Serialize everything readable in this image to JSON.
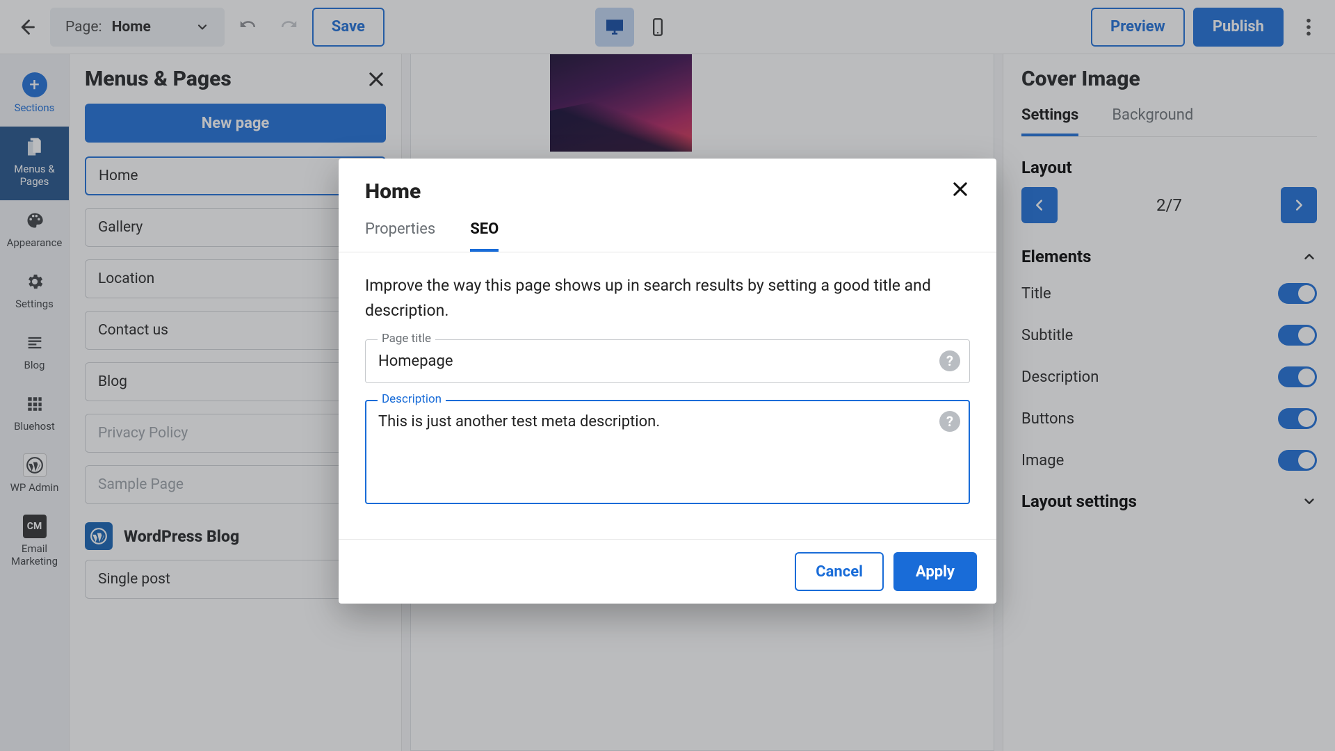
{
  "topbar": {
    "page_label": "Page:",
    "page_value": "Home",
    "save": "Save",
    "preview": "Preview",
    "publish": "Publish"
  },
  "rail": {
    "sections": "Sections",
    "menus_pages": "Menus & Pages",
    "appearance": "Appearance",
    "settings": "Settings",
    "blog": "Blog",
    "bluehost": "Bluehost",
    "wp_admin": "WP Admin",
    "email_marketing": "Email Marketing",
    "cm_badge": "CM"
  },
  "leftpanel": {
    "title": "Menus & Pages",
    "new_page": "New page",
    "pages": [
      {
        "label": "Home",
        "selected": true,
        "home": true
      },
      {
        "label": "Gallery"
      },
      {
        "label": "Location"
      },
      {
        "label": "Contact us"
      },
      {
        "label": "Blog"
      },
      {
        "label": "Privacy Policy",
        "hidden": true
      },
      {
        "label": "Sample Page",
        "hidden": true
      }
    ],
    "site_title": "WordPress Blog",
    "single_post": "Single post"
  },
  "rightpanel": {
    "title": "Cover Image",
    "tabs": {
      "settings": "Settings",
      "background": "Background"
    },
    "layout_label": "Layout",
    "layout_counter": "2/7",
    "elements_label": "Elements",
    "elements": [
      {
        "label": "Title",
        "on": true
      },
      {
        "label": "Subtitle",
        "on": true
      },
      {
        "label": "Description",
        "on": true
      },
      {
        "label": "Buttons",
        "on": true
      },
      {
        "label": "Image",
        "on": true
      }
    ],
    "layout_settings_label": "Layout settings"
  },
  "modal": {
    "title": "Home",
    "tabs": {
      "properties": "Properties",
      "seo": "SEO"
    },
    "intro": "Improve the way this page shows up in search results by setting a good title and description.",
    "page_title_label": "Page title",
    "page_title_value": "Homepage",
    "description_label": "Description",
    "description_value": "This is just another test meta description.",
    "cancel": "Cancel",
    "apply": "Apply"
  }
}
